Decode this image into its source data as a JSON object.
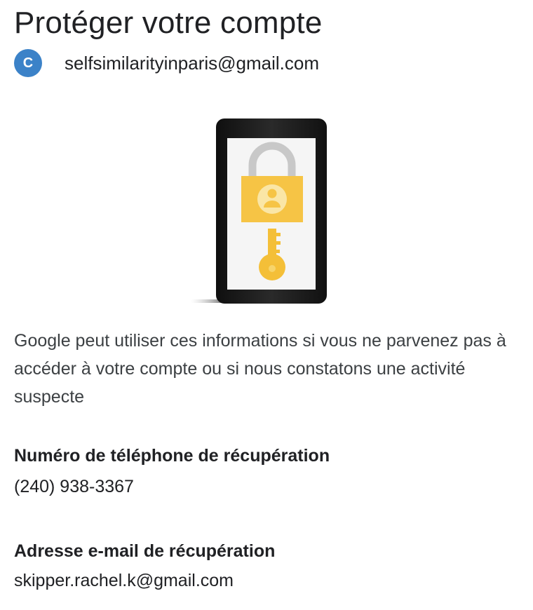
{
  "page": {
    "title": "Protéger votre compte"
  },
  "account": {
    "avatar_letter": "C",
    "email": "selfsimilarityinparis@gmail.com"
  },
  "illustration": {
    "icon": "phone-lock-key-illustration",
    "colors": {
      "phone_frame": "#1c1c1c",
      "screen": "#f5f5f5",
      "lock_body": "#f6c445",
      "lock_shackle": "#c8c8c8",
      "key": "#f4bf38"
    }
  },
  "description": "Google peut utiliser ces informations si vous ne parvenez pas à accéder à votre compte ou si nous constatons une activité suspecte",
  "recovery_phone": {
    "label": "Numéro de téléphone de récupération",
    "value": "(240) 938-3367"
  },
  "recovery_email": {
    "label": "Adresse e-mail de récupération",
    "value": "skipper.rachel.k@gmail.com"
  },
  "colors": {
    "text_primary": "#202124",
    "text_secondary": "#3c4043",
    "avatar_bg": "#3b82c8"
  }
}
